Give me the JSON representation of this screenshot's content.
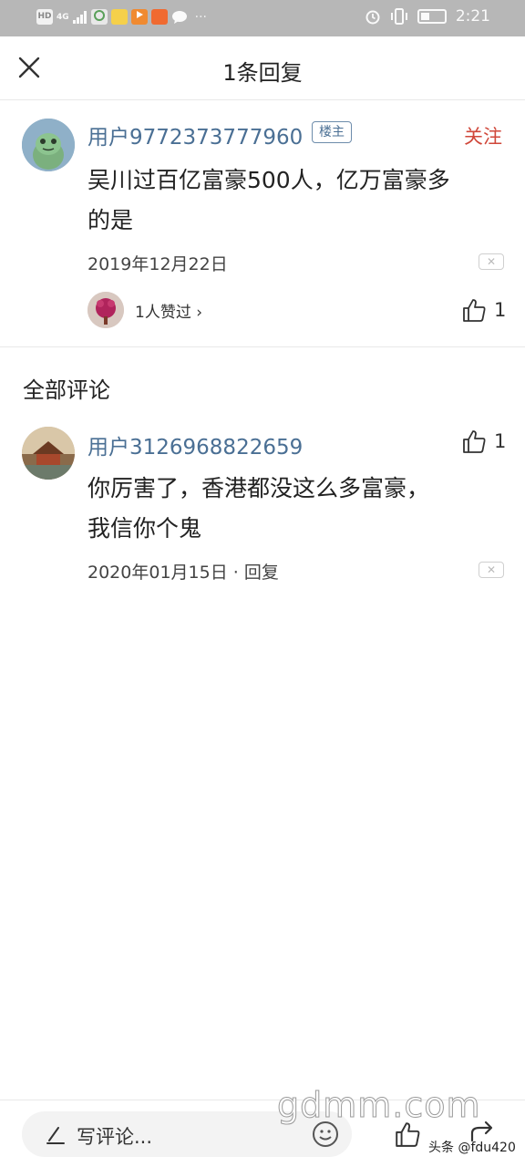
{
  "status_bar": {
    "hd": "HD",
    "network": "4G",
    "time": "2:21",
    "overflow": "···"
  },
  "header": {
    "title": "1条回复"
  },
  "main_reply": {
    "username": "用户9772373777960",
    "owner_badge": "楼主",
    "follow_label": "关注",
    "content_line1": "吴川过百亿富豪500人，亿万富豪多",
    "content_line2": "的是",
    "date": "2019年12月22日",
    "likers_text": "1人赞过 ›",
    "like_count": "1"
  },
  "section_title": "全部评论",
  "comments": [
    {
      "username": "用户3126968822659",
      "like_count": "1",
      "content_line1": "你厉害了，香港都没这么多富豪，",
      "content_line2": "我信你个鬼",
      "date_reply": "2020年01月15日 · 回复"
    }
  ],
  "bottom_bar": {
    "write_placeholder": "写评论..."
  },
  "watermark": {
    "text": "gdmm.com",
    "source": "头条 @fdu420"
  },
  "colors": {
    "username": "#4a6f94",
    "follow": "#d0473a",
    "status_bar": "#b7b7b7"
  }
}
